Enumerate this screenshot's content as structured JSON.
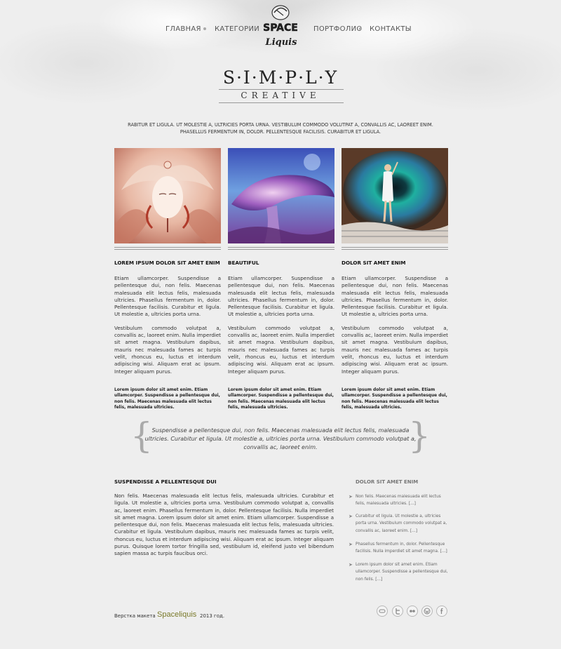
{
  "nav": {
    "items": [
      "ГЛАВНАЯ",
      "КАТЕГОРИИ",
      "ПОРТФОЛИО",
      "КОНТАКТЫ"
    ]
  },
  "logo": {
    "line1": "SPACE",
    "line2": "Liquis"
  },
  "hero": {
    "title": "S·I·M·P·L·Y",
    "subtitle": "CREATIVE"
  },
  "intro": {
    "line1": "RABITUR ET LIGULA. UT MOLESTIE A, ULTRICIES PORTA URNA. VESTIBULUM COMMODO VOLUTPAT A, CONVALLIS AC, LAOREET ENIM.",
    "line2": "PHASELLUS FERMENTUM IN, DOLOR. PELLENTESQUE FACILISIS. CURABITUR ET LIGULA."
  },
  "columns": [
    {
      "title": "LOREM IPSUM DOLOR SIT AMET ENIM",
      "p1": "Etiam ullamcorper. Suspendisse a pellentesque dui, non felis. Maecenas malesuada elit lectus felis, malesuada ultricies. Phasellus fermentum in, dolor. Pellentesque facilisis. Curabitur et ligula. Ut molestie a, ultricies porta urna.",
      "p2": "Vestibulum commodo volutpat a, convallis ac, laoreet enim. Nulla imperdiet sit amet magna. Vestibulum dapibus, mauris nec malesuada fames ac turpis velit, rhoncus eu, luctus et interdum adipiscing wisi. Aliquam erat ac ipsum. Integer aliquam purus.",
      "bold": "Lorem ipsum dolor sit amet enim. Etiam ullamcorper. Suspendisse a pellentesque dui, non felis. Maecenas malesuada elit lectus felis, malesuada ultricies."
    },
    {
      "title": "BEAUTIFUL",
      "p1": "Etiam ullamcorper. Suspendisse a pellentesque dui, non felis. Maecenas malesuada elit lectus felis, malesuada ultricies. Phasellus fermentum in, dolor. Pellentesque facilisis. Curabitur et ligula. Ut molestie a, ultricies porta urna.",
      "p2": "Vestibulum commodo volutpat a, convallis ac, laoreet enim. Nulla imperdiet sit amet magna. Vestibulum dapibus, mauris nec malesuada fames ac turpis velit, rhoncus eu, luctus et interdum adipiscing wisi. Aliquam erat ac ipsum. Integer aliquam purus.",
      "bold": "Lorem ipsum dolor sit amet enim. Etiam ullamcorper. Suspendisse a pellentesque dui, non felis. Maecenas malesuada elit lectus felis, malesuada ultricies."
    },
    {
      "title": "DOLOR SIT AMET ENIM",
      "p1": "Etiam ullamcorper. Suspendisse a pellentesque dui, non felis. Maecenas malesuada elit lectus felis, malesuada ultricies. Phasellus fermentum in, dolor. Pellentesque facilisis. Curabitur et ligula. Ut molestie a, ultricies porta urna.",
      "p2": "Vestibulum commodo volutpat a, convallis ac, laoreet enim. Nulla imperdiet sit amet magna. Vestibulum dapibus, mauris nec malesuada fames ac turpis velit, rhoncus eu, luctus et interdum adipiscing wisi. Aliquam erat ac ipsum. Integer aliquam purus.",
      "bold": "Lorem ipsum dolor sit amet enim. Etiam ullamcorper. Suspendisse a pellentesque dui, non felis. Maecenas malesuada elit lectus felis, malesuada ultricies."
    }
  ],
  "quote": "Suspendisse a pellentesque dui, non felis. Maecenas malesuada elit lectus felis, malesuada ultricies. Curabitur et ligula. Ut molestie a, ultricies porta urna. Vestibulum commodo volutpat a, convallis ac, laoreet enim.",
  "lower": {
    "title": "SUSPENDISSE A PELLENTESQUE DUI",
    "text": "Non felis. Maecenas malesuada elit lectus felis, malesuada ultricies. Curabitur et ligula. Ut molestie a, ultricies porta urna. Vestibulum commodo volutpat a, convallis ac, laoreet enim. Phasellus fermentum in, dolor. Pellentesque facilisis. Nulla imperdiet sit amet magna. Lorem ipsum dolor sit amet enim. Etiam ullamcorper. Suspendisse a pellentesque dui, non felis. Maecenas malesuada elit lectus felis, malesuada ultricies. Curabitur et ligula. Vestibulum dapibus, mauris nec malesuada fames ac turpis velit, rhoncus eu, luctus et interdum adipiscing wisi. Aliquam erat ac ipsum. Integer aliquam purus. Quisque lorem tortor fringilla sed, vestibulum id, eleifend justo vel bibendum sapien massa ac turpis faucibus orci."
  },
  "sidebar": {
    "title": "DOLOR SIT AMET ENIM",
    "items": [
      "Non felis. Maecenas malesuada elit lectus felis, malesuada ultricies. [...]",
      "Curabitur et ligula. Ut molestie a, ultricies porta urna. Vestibulum commodo volutpat a, convallis ac, laoreet enim. [...]",
      "Phasellus fermentum in, dolor. Pellentesque facilisis. Nulla imperdiet sit amet magna. [...]",
      "Lorem ipsum dolor sit amet enim. Etiam ullamcorper. Suspendisse a pellentesque dui, non felis. [...]"
    ]
  },
  "footer": {
    "prefix": "Верстка макета",
    "brand": "Spaceliquis",
    "year": "2013 год."
  },
  "social_icons": [
    "delicious-icon",
    "twitter-icon",
    "flickr-icon",
    "wordpress-icon",
    "facebook-icon"
  ],
  "colors": {
    "background": "#eeeeee",
    "brand": "#7a7a2a",
    "text": "#333333"
  }
}
